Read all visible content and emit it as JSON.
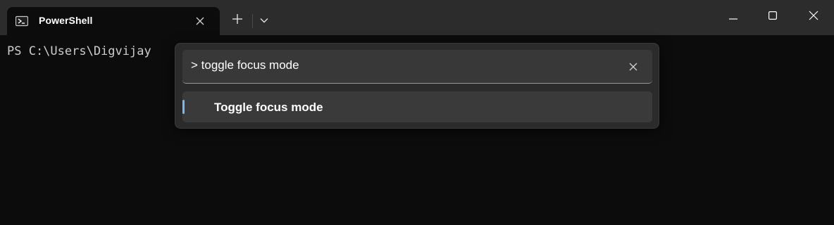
{
  "tab": {
    "title": "PowerShell",
    "icon": "powershell-icon"
  },
  "titlebar": {
    "new_tab_icon": "plus-icon",
    "dropdown_icon": "chevron-down-icon",
    "window_controls": [
      "minimize-icon",
      "maximize-icon",
      "close-icon"
    ]
  },
  "terminal": {
    "prompt_text": "PS C:\\Users\\Digvijay"
  },
  "command_palette": {
    "search_value": "> toggle focus mode",
    "results": [
      {
        "label": "Toggle focus mode"
      }
    ]
  },
  "colors": {
    "titlebar_bg": "#2c2c2c",
    "terminal_bg": "#0c0c0c",
    "palette_bg": "#2b2b2b",
    "accent": "#76b9ed"
  }
}
